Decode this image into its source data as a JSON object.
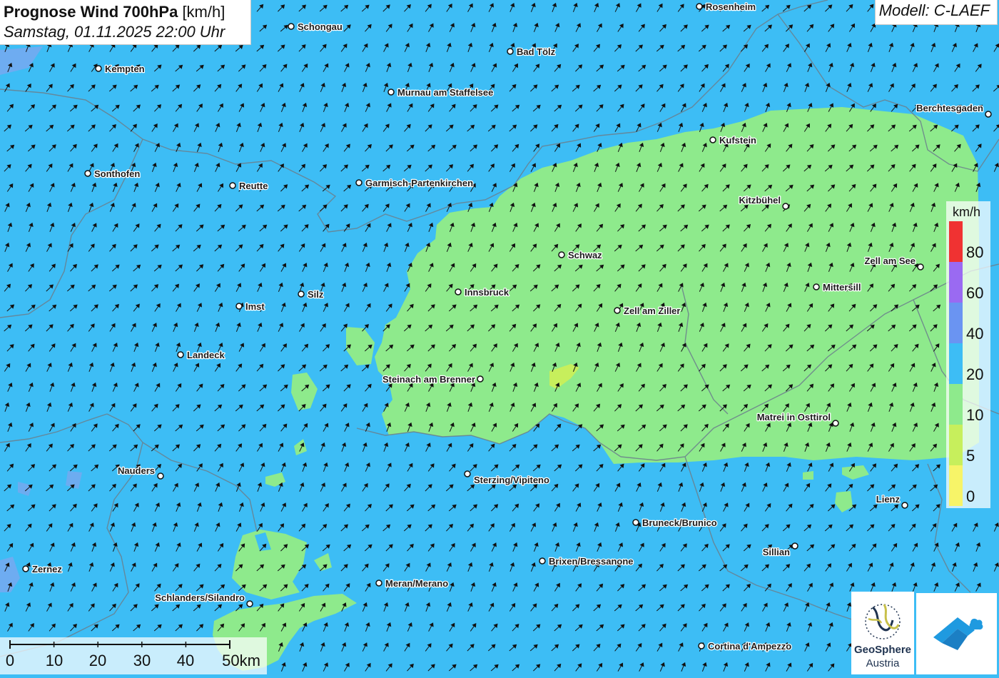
{
  "header": {
    "title": "Prognose Wind 700hPa",
    "unit": "[km/h]",
    "datetime": "Samstag, 01.11.2025 22:00 Uhr"
  },
  "model": "Modell: C-LAEF",
  "legend": {
    "unit": "km/h",
    "classes": [
      {
        "label": "80",
        "color": "#f03232"
      },
      {
        "label": "60",
        "color": "#9a6af2"
      },
      {
        "label": "40",
        "color": "#6a94f2"
      },
      {
        "label": "20",
        "color": "#3dbdf5"
      },
      {
        "label": "10",
        "color": "#8eea8c"
      },
      {
        "label": "5",
        "color": "#c7ef5c"
      },
      {
        "label": "0",
        "color": "#f7f468"
      }
    ]
  },
  "scalebar": {
    "labels": [
      "0",
      "10",
      "20",
      "30",
      "40",
      "50km"
    ]
  },
  "cities": [
    {
      "name": "Rosenheim"
    },
    {
      "name": "Schongau"
    },
    {
      "name": "Bad Tölz"
    },
    {
      "name": "Kempten"
    },
    {
      "name": "Murnau am Staffelsee"
    },
    {
      "name": "Berchtesgaden"
    },
    {
      "name": "Kufstein"
    },
    {
      "name": "Sonthofen"
    },
    {
      "name": "Reutte"
    },
    {
      "name": "Garmisch-Partenkirchen"
    },
    {
      "name": "Kitzbühel"
    },
    {
      "name": "Schwaz"
    },
    {
      "name": "Zell am See"
    },
    {
      "name": "Mittersill"
    },
    {
      "name": "Innsbruck"
    },
    {
      "name": "Silz"
    },
    {
      "name": "Imst"
    },
    {
      "name": "Zell am Ziller"
    },
    {
      "name": "Landeck"
    },
    {
      "name": "Steinach am Brenner"
    },
    {
      "name": "Matrei in Osttirol"
    },
    {
      "name": "Nauders"
    },
    {
      "name": "Sterzing/Vipiteno"
    },
    {
      "name": "Lienz"
    },
    {
      "name": "Bruneck/Brunico"
    },
    {
      "name": "Sillian"
    },
    {
      "name": "Brixen/Bressanone"
    },
    {
      "name": "Zernez"
    },
    {
      "name": "Meran/Merano"
    },
    {
      "name": "Schlanders/Silandro"
    },
    {
      "name": "Cortina d'Ampezzo"
    }
  ],
  "logo": {
    "line1": "GeoSphere",
    "line2": "Austria"
  },
  "colors": {
    "wind_20_40": "#3dbdf5",
    "wind_10_20": "#8eea8c",
    "wind_5_10": "#c7ef5c",
    "wind_40_60": "#6a94f2"
  }
}
